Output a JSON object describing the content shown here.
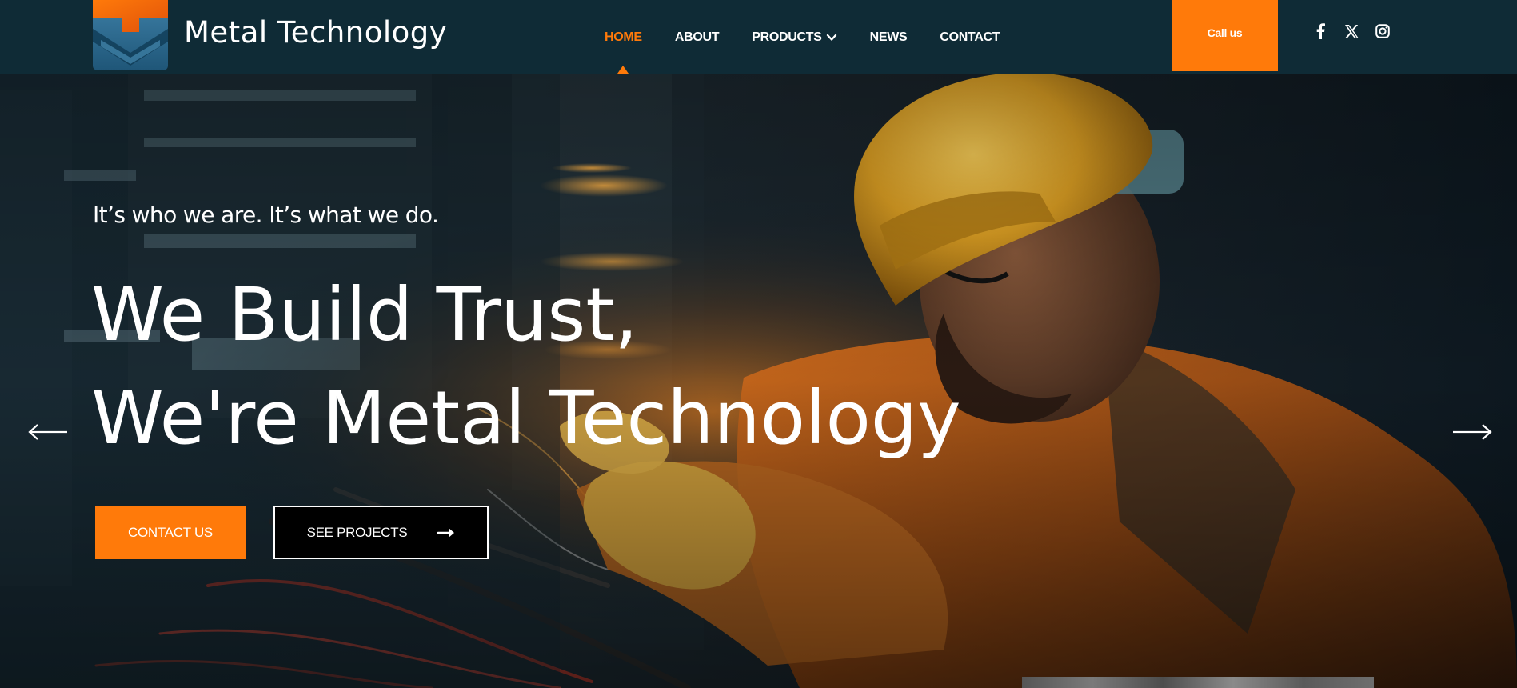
{
  "brand": {
    "name": "Metal Technology"
  },
  "nav": {
    "items": [
      {
        "label": "HOME",
        "active": true
      },
      {
        "label": "ABOUT",
        "active": false
      },
      {
        "label": "PRODUCTS",
        "active": false,
        "has_dropdown": true
      },
      {
        "label": "NEWS",
        "active": false
      },
      {
        "label": "CONTACT",
        "active": false
      }
    ]
  },
  "header": {
    "call_label": "Call us"
  },
  "socials": [
    "facebook-icon",
    "x-icon",
    "instagram-icon"
  ],
  "hero": {
    "tagline": "It’s who we are. It’s what we do.",
    "headline_line1": "We Build Trust,",
    "headline_line2": "We're Metal Technology",
    "contact_button": "CONTACT US",
    "projects_button": "SEE PROJECTS"
  },
  "colors": {
    "header_bg": "#0f2b36",
    "accent": "#ff7a0a",
    "text": "#ffffff"
  }
}
